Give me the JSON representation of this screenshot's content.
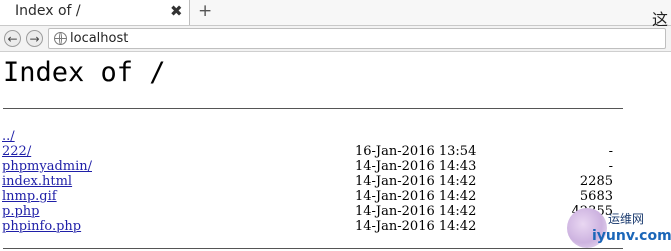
{
  "browser": {
    "tab_title": "Index of /",
    "tab_close": "✖",
    "new_tab": "+",
    "corner_char": "这",
    "back": "←",
    "forward": "→",
    "url": "localhost"
  },
  "page": {
    "heading": "Index of /",
    "entries": [
      {
        "name": "../",
        "date": "",
        "size": ""
      },
      {
        "name": "222/",
        "date": "16-Jan-2016 13:54",
        "size": "-"
      },
      {
        "name": "phpmyadmin/",
        "date": "14-Jan-2016 14:43",
        "size": "-"
      },
      {
        "name": "index.html",
        "date": "14-Jan-2016 14:42",
        "size": "2285"
      },
      {
        "name": "lnmp.gif",
        "date": "14-Jan-2016 14:42",
        "size": "5683"
      },
      {
        "name": "p.php",
        "date": "14-Jan-2016 14:42",
        "size": "42355"
      },
      {
        "name": "phpinfo.php",
        "date": "14-Jan-2016 14:42",
        "size": ""
      }
    ]
  },
  "watermark": {
    "line1": "运维网",
    "line2": "iyunv.com"
  }
}
